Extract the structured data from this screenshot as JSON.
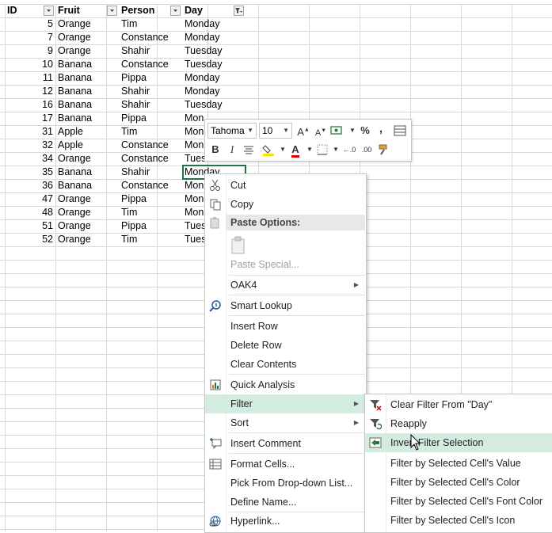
{
  "sheet": {
    "headers": {
      "id": "ID",
      "fruit": "Fruit",
      "person": "Person",
      "day": "Day"
    },
    "rows": [
      {
        "id": "5",
        "fruit": "Orange",
        "person": "Tim",
        "day": "Monday"
      },
      {
        "id": "7",
        "fruit": "Orange",
        "person": "Constance",
        "day": "Monday"
      },
      {
        "id": "9",
        "fruit": "Orange",
        "person": "Shahir",
        "day": "Tuesday"
      },
      {
        "id": "10",
        "fruit": "Banana",
        "person": "Constance",
        "day": "Tuesday"
      },
      {
        "id": "11",
        "fruit": "Banana",
        "person": "Pippa",
        "day": "Monday"
      },
      {
        "id": "12",
        "fruit": "Banana",
        "person": "Shahir",
        "day": "Monday"
      },
      {
        "id": "16",
        "fruit": "Banana",
        "person": "Shahir",
        "day": "Tuesday"
      },
      {
        "id": "17",
        "fruit": "Banana",
        "person": "Pippa",
        "day": "Mon"
      },
      {
        "id": "31",
        "fruit": "Apple",
        "person": "Tim",
        "day": "Mon"
      },
      {
        "id": "32",
        "fruit": "Apple",
        "person": "Constance",
        "day": "Mon"
      },
      {
        "id": "34",
        "fruit": "Orange",
        "person": "Constance",
        "day": "Tuesd"
      },
      {
        "id": "35",
        "fruit": "Banana",
        "person": "Shahir",
        "day": "Monday"
      },
      {
        "id": "36",
        "fruit": "Banana",
        "person": "Constance",
        "day": "Mon"
      },
      {
        "id": "47",
        "fruit": "Orange",
        "person": "Pippa",
        "day": "Mon"
      },
      {
        "id": "48",
        "fruit": "Orange",
        "person": "Tim",
        "day": "Mon"
      },
      {
        "id": "51",
        "fruit": "Orange",
        "person": "Pippa",
        "day": "Tues"
      },
      {
        "id": "52",
        "fruit": "Orange",
        "person": "Tim",
        "day": "Tues"
      }
    ]
  },
  "mini_toolbar": {
    "font_name": "Tahoma",
    "font_size": "10",
    "percent": "%",
    "comma": ",",
    "bold": "B",
    "italic": "I",
    "font_color_letter": "A",
    "accent_fill": "#f5e600",
    "accent_font": "#e00000"
  },
  "context_menu": {
    "cut": "Cut",
    "copy": "Copy",
    "paste_options": "Paste Options:",
    "paste_special": "Paste Special...",
    "oak4": "OAK4",
    "smart_lookup": "Smart Lookup",
    "insert_row": "Insert Row",
    "delete_row": "Delete Row",
    "clear_contents": "Clear Contents",
    "quick_analysis": "Quick Analysis",
    "filter": "Filter",
    "sort": "Sort",
    "insert_comment": "Insert Comment",
    "format_cells": "Format Cells...",
    "pick_dropdown": "Pick From Drop-down List...",
    "define_name": "Define Name...",
    "hyperlink": "Hyperlink..."
  },
  "filter_submenu": {
    "clear_filter": "Clear Filter From \"Day\"",
    "reapply": "Reapply",
    "invert": "Invert Filter Selection",
    "by_value": "Filter by Selected Cell's Value",
    "by_color": "Filter by Selected Cell's Color",
    "by_font_color": "Filter by Selected Cell's Font Color",
    "by_icon": "Filter by Selected Cell's Icon"
  },
  "colors": {
    "highlight": "#d4ecdf",
    "selection": "#217346"
  }
}
